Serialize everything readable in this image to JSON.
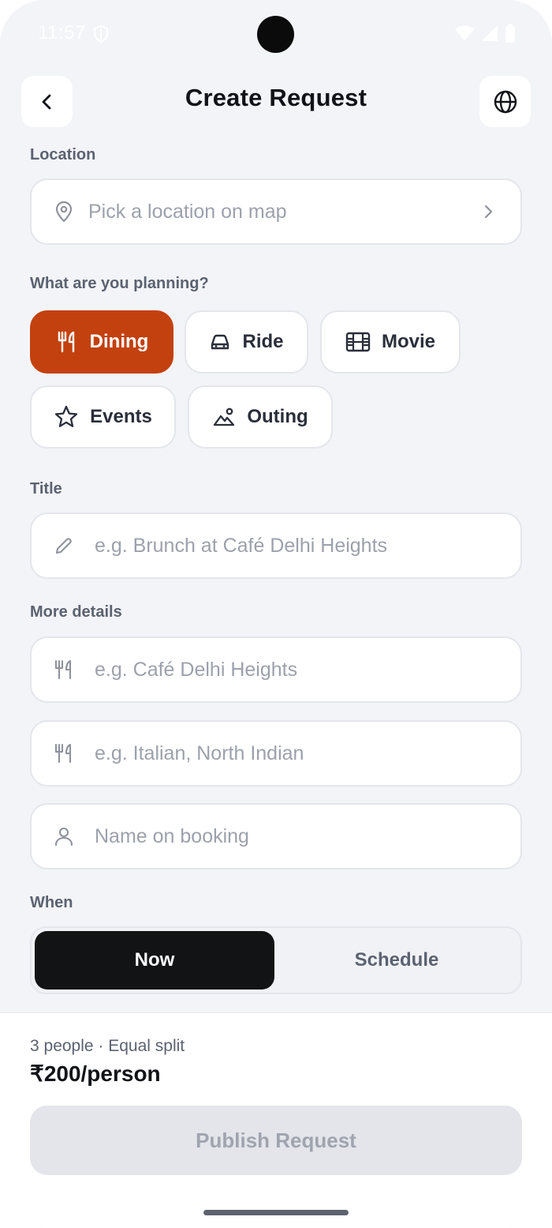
{
  "status_bar": {
    "time": "11:57"
  },
  "header": {
    "title": "Create Request"
  },
  "location": {
    "label": "Location",
    "placeholder": "Pick a location on map"
  },
  "planning": {
    "label": "What are you planning?",
    "chips": [
      {
        "label": "Dining",
        "icon": "utensils-icon",
        "active": true
      },
      {
        "label": "Ride",
        "icon": "car-icon",
        "active": false
      },
      {
        "label": "Movie",
        "icon": "film-icon",
        "active": false
      },
      {
        "label": "Events",
        "icon": "star-icon",
        "active": false
      },
      {
        "label": "Outing",
        "icon": "landscape-icon",
        "active": false
      }
    ]
  },
  "title_field": {
    "label": "Title",
    "placeholder": "e.g. Brunch at Café Delhi Heights"
  },
  "details": {
    "label": "More details",
    "venue_placeholder": "e.g. Café Delhi Heights",
    "cuisine_placeholder": "e.g. Italian, North Indian",
    "booking_placeholder": "Name on booking"
  },
  "when": {
    "label": "When",
    "options": [
      "Now",
      "Schedule"
    ],
    "selected": "Now"
  },
  "footer": {
    "split_info": "3 people · Equal split",
    "price": "₹200/person",
    "publish_label": "Publish Request"
  },
  "colors": {
    "accent": "#c3410f",
    "background": "#f3f4f8",
    "segment_active": "#121315"
  }
}
